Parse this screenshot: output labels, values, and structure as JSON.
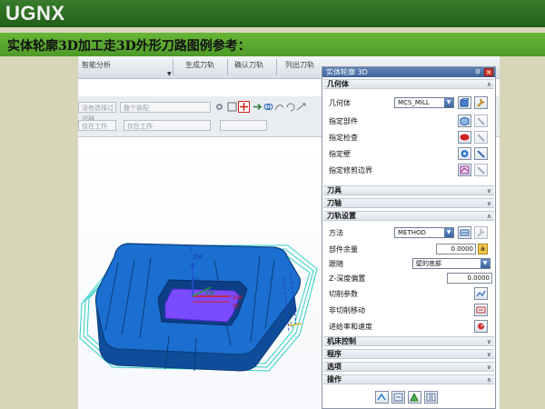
{
  "slide": {
    "title": "UGNX",
    "subtitle": "实体轮廓3D加工走3D外形刀路图例参考："
  },
  "nx": {
    "ribbon": {
      "labels": [
        "智能分析",
        "生成刀轨",
        "确认刀轨",
        "列出刀轨"
      ]
    },
    "toolbar": {
      "filter1": "没有选择过滤器",
      "filter2": "整个装配",
      "filter3": "仅在工作",
      "filter4": "仅在工作"
    },
    "axes": {
      "zm": "ZM",
      "zc": "ZC",
      "ym": "YM",
      "xm": "XM",
      "xc": "XC"
    }
  },
  "panel": {
    "title": "实体轮廓 3D",
    "sections": {
      "geometry": "几何体",
      "tool": "刀具",
      "axis": "刀轴",
      "path_settings": "刀轨设置",
      "machine_control": "机床控制",
      "program": "程序",
      "options": "选项",
      "actions": "操作"
    },
    "geometry_rows": {
      "geometry_label": "几何体",
      "geometry_value": "MCS_MILL",
      "specify_part": "指定部件",
      "specify_check": "指定检查",
      "specify_wall": "指定壁",
      "specify_trim": "指定修剪边界"
    },
    "path_rows": {
      "method_label": "方法",
      "method_value": "METHOD",
      "stock_label": "部件余量",
      "stock_value": "0.0000",
      "follow_label": "跟随",
      "follow_value": "壁的底部",
      "zdepth_label": "Z-深度偏置",
      "zdepth_value": "0.0000",
      "cut_params": "切削参数",
      "noncut_moves": "非切削移动",
      "feeds_speeds": "进给率和速度"
    }
  },
  "colors": {
    "title_bar": "#2a6e22",
    "subtitle_bar": "#5aa830",
    "panel_header": "#3e649a",
    "part_body": "#1b6fd0",
    "floor": "#7b4bff",
    "toolpath": "#2ed0c8"
  }
}
